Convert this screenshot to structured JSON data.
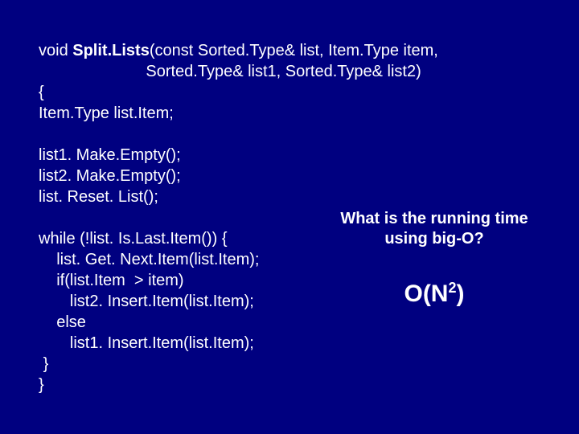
{
  "signature": {
    "kw_void": "void ",
    "fn_name": "Split.Lists",
    "params1": "(const Sorted.Type& list, Item.Type item,",
    "params2": "Sorted.Type& list1, Sorted.Type& list2)"
  },
  "code": {
    "open_brace": "{",
    "decl": "Item.Type list.Item;",
    "l1": "list1. Make.Empty();",
    "l2": "list2. Make.Empty();",
    "l3": "list. Reset. List();",
    "w1": "while (!list. Is.Last.Item()) {",
    "w2": "list. Get. Next.Item(list.Item);",
    "w3": "if(list.Item  > item)",
    "w4": "list2. Insert.Item(list.Item);",
    "w5": "else",
    "w6": "list1. Insert.Item(list.Item);",
    "close_inner": "}",
    "close_outer": "}"
  },
  "question": {
    "line1": "What is the running time",
    "line2": "using big-O?"
  },
  "answer": {
    "prefix": "O(N",
    "exp": "2",
    "suffix": ")"
  }
}
